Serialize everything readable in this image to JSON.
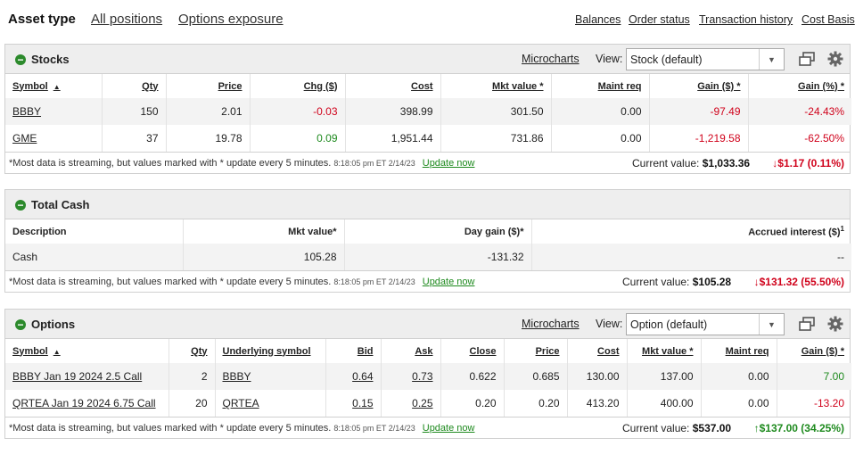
{
  "nav": {
    "left": [
      "Asset type",
      "All positions",
      "Options exposure"
    ],
    "right": [
      "Balances",
      "Order status",
      "Transaction history",
      "Cost Basis"
    ]
  },
  "common": {
    "microcharts": "Microcharts",
    "view_label": "View:",
    "note": "*Most data is streaming, but values marked with * update every 5 minutes.",
    "timestamp": "8:18:05 pm ET 2/14/23",
    "update_now": "Update now",
    "current_value_label": "Current value:",
    "colors": {
      "negative": "#d0021b",
      "positive": "#1e8a1e",
      "header_bg": "#eeeeee"
    }
  },
  "stocks": {
    "title": "Stocks",
    "view_value": "Stock (default)",
    "columns": [
      "Symbol",
      "Qty",
      "Price",
      "Chg ($)",
      "Cost",
      "Mkt value *",
      "Maint req",
      "Gain ($) *",
      "Gain (%) *"
    ],
    "rows": [
      [
        "BBBY",
        "150",
        "2.01",
        "-0.03",
        "398.99",
        "301.50",
        "0.00",
        "-97.49",
        "-24.43%"
      ],
      [
        "GME",
        "37",
        "19.78",
        "0.09",
        "1,951.44",
        "731.86",
        "0.00",
        "-1,219.58",
        "-62.50%"
      ]
    ],
    "current_value": "$1,033.36",
    "change": "↓$1.17 (0.11%)"
  },
  "cash": {
    "title": "Total Cash",
    "columns": [
      "Description",
      "Mkt value*",
      "Day gain ($)*",
      "Accrued interest ($)"
    ],
    "accrued_footnote": "1",
    "rows": [
      [
        "Cash",
        "105.28",
        "-131.32",
        "--"
      ]
    ],
    "current_value": "$105.28",
    "change": "↓$131.32 (55.50%)"
  },
  "options": {
    "title": "Options",
    "view_value": "Option (default)",
    "columns": [
      "Symbol",
      "Qty",
      "Underlying symbol",
      "Bid",
      "Ask",
      "Close",
      "Price",
      "Cost",
      "Mkt value *",
      "Maint req",
      "Gain ($) *"
    ],
    "rows": [
      [
        "BBBY Jan 19 2024 2.5 Call",
        "2",
        "BBBY",
        "0.64",
        "0.73",
        "0.622",
        "0.685",
        "130.00",
        "137.00",
        "0.00",
        "7.00"
      ],
      [
        "QRTEA Jan 19 2024 6.75 Call",
        "20",
        "QRTEA",
        "0.15",
        "0.25",
        "0.20",
        "0.20",
        "413.20",
        "400.00",
        "0.00",
        "-13.20"
      ]
    ],
    "current_value": "$537.00",
    "change": "↑$137.00 (34.25%)"
  }
}
